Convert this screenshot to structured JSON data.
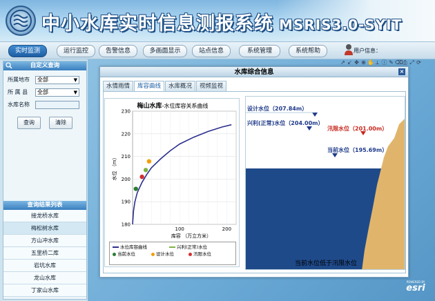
{
  "header": {
    "title": "中小水库实时信息测报系统",
    "version": "MSRIS3.0-SYIT"
  },
  "nav": {
    "items": [
      "实时监测",
      "运行监控",
      "告警信息",
      "多画面显示",
      "站点信息",
      "系统管理",
      "系统帮助"
    ],
    "active_index": 0,
    "user_label": "用户信息："
  },
  "query": {
    "title": "自定义查询",
    "city_label": "所属地市",
    "city_value": "全部",
    "county_label": "所 属 县",
    "county_value": "全部",
    "name_label": "水库名称",
    "name_value": "",
    "search_btn": "查询",
    "clear_btn": "清除"
  },
  "results": {
    "title": "查询结果列表",
    "items": [
      "接龙桥水库",
      "梅松树水库",
      "方山冲水库",
      "五里桥二库",
      "岩坑水库",
      "龙山水库",
      "丁家山水库"
    ],
    "selected_index": 1
  },
  "modal": {
    "title": "水库综合信息",
    "close": "×",
    "tabs": [
      "水情雨情",
      "库容曲线",
      "水库概况",
      "视频监视"
    ],
    "active_tab": 1
  },
  "chart_data": {
    "type": "line",
    "title_bold": "梅山水库",
    "title_rest": "-水位库容关系曲线",
    "xlabel": "库容 （万立方米）",
    "ylabel": "水位 （m）",
    "xlim": [
      0,
      220
    ],
    "ylim": [
      180,
      230
    ],
    "x_ticks": [
      100,
      200
    ],
    "y_ticks": [
      180,
      190,
      200,
      210,
      220,
      230
    ],
    "series": [
      {
        "name": "水位库容曲线",
        "color": "#2b2f8c",
        "x": [
          0,
          2,
          5,
          10,
          20,
          30,
          40,
          60,
          80,
          100,
          130,
          160,
          190,
          210
        ],
        "y": [
          180,
          186,
          190,
          194,
          198.5,
          202,
          205,
          209,
          212.5,
          215.5,
          218.5,
          221,
          223,
          224
        ]
      }
    ],
    "points": [
      {
        "name": "当前水位",
        "x": 7,
        "y": 195.69,
        "color": "#2e7d32"
      },
      {
        "name": "汛限水位",
        "x": 20,
        "y": 201.0,
        "color": "#d32f2f"
      },
      {
        "name": "兴利(正常)水位",
        "x": 28,
        "y": 204.0,
        "color": "#7cb342"
      },
      {
        "name": "设计水位",
        "x": 35,
        "y": 207.84,
        "color": "#f59e0b"
      }
    ],
    "legend": [
      "水位库容曲线",
      "兴利(正常)水位",
      "当前水位",
      "设计水位",
      "汛限水位"
    ]
  },
  "diagram": {
    "levels": [
      {
        "text": "设计水位（207.84m）",
        "color": "#1e3a8a"
      },
      {
        "text": "兴利(正常)水位（204.00m）",
        "color": "#1e3a8a"
      },
      {
        "text": "汛限水位（201.00m）",
        "color": "#c8281e"
      },
      {
        "text": "当前水位（195.69m）",
        "color": "#1e3a8a"
      }
    ],
    "caption": "当前水位低于汛限水位"
  },
  "branding": {
    "powered": "POWERED BY",
    "name": "esri"
  },
  "colors": {
    "accent": "#1d5ea4",
    "water": "#1f4a8a",
    "soil": "#e0b56b"
  }
}
